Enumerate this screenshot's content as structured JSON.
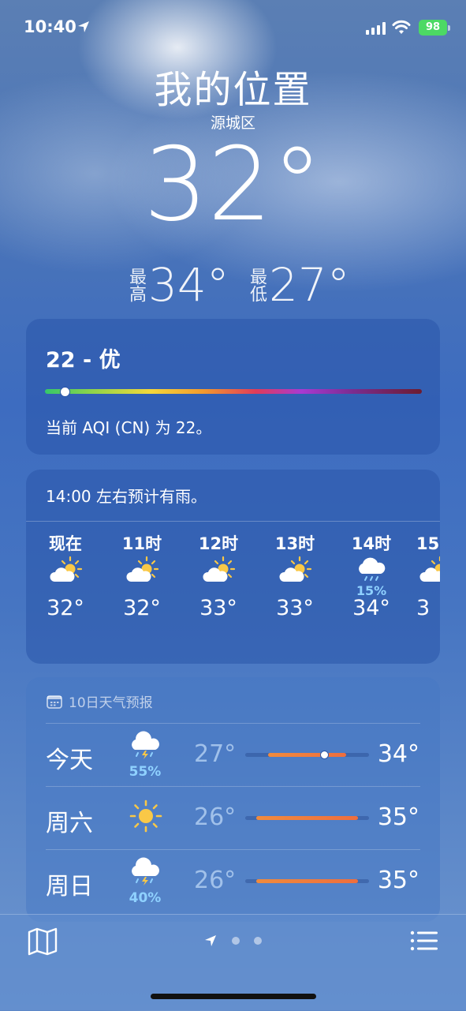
{
  "status_bar": {
    "time": "10:40",
    "battery": "98"
  },
  "header": {
    "location": "我的位置",
    "district": "源城区",
    "temperature": "32°"
  },
  "hilo": {
    "high_label": "最高",
    "high": "34°",
    "low_label": "最低",
    "low": "27°"
  },
  "aqi": {
    "title": "22 - 优",
    "value": 22,
    "description": "当前 AQI (CN) 为 22。"
  },
  "hourly": {
    "note": "14:00 左右预计有雨。",
    "items": [
      {
        "label": "现在",
        "icon": "partly-sunny-icon",
        "temp": "32°",
        "precip": ""
      },
      {
        "label": "11时",
        "icon": "partly-sunny-icon",
        "temp": "32°",
        "precip": ""
      },
      {
        "label": "12时",
        "icon": "partly-sunny-icon",
        "temp": "33°",
        "precip": ""
      },
      {
        "label": "13时",
        "icon": "partly-sunny-icon",
        "temp": "33°",
        "precip": ""
      },
      {
        "label": "14时",
        "icon": "rain-cloud-icon",
        "temp": "34°",
        "precip": "15%"
      },
      {
        "label": "15",
        "icon": "partly-sunny-icon",
        "temp": "3",
        "precip": ""
      }
    ]
  },
  "daily": {
    "header": "10日天气预报",
    "days": [
      {
        "name": "今天",
        "icon": "thunderstorm-icon",
        "precip": "55%",
        "low": "27°",
        "high": "34°",
        "range": [
          27,
          34
        ],
        "current": 32
      },
      {
        "name": "周六",
        "icon": "sun-icon",
        "precip": "",
        "low": "26°",
        "high": "35°",
        "range": [
          26,
          35
        ]
      },
      {
        "name": "周日",
        "icon": "thunderstorm-icon",
        "precip": "40%",
        "low": "26°",
        "high": "35°",
        "range": [
          26,
          35
        ]
      }
    ],
    "week_range": [
      25,
      36
    ]
  },
  "colors": {
    "accent_precip": "#8fd1ff",
    "bar_fill": "#f08b3d",
    "battery": "#4cd964"
  }
}
